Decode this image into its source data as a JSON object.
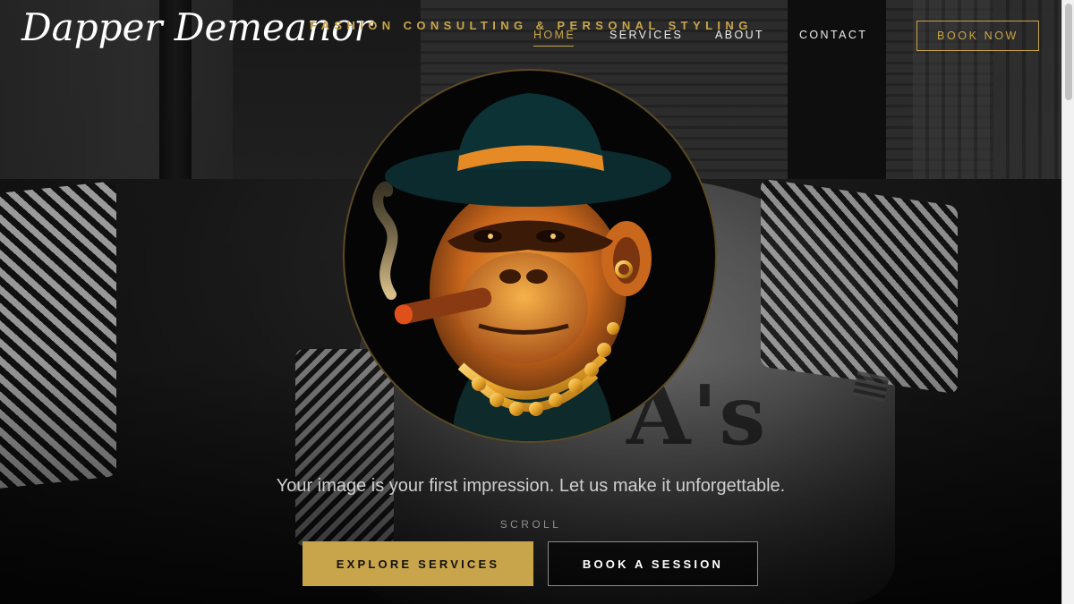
{
  "brand": {
    "logo_text": "Dapper Demeanor",
    "tagline": "FASHION CONSULTING & PERSONAL STYLING",
    "accent_color": "#c8a54a"
  },
  "nav": {
    "items": [
      {
        "label": "HOME",
        "active": true
      },
      {
        "label": "SERVICES",
        "active": false
      },
      {
        "label": "ABOUT",
        "active": false
      },
      {
        "label": "CONTACT",
        "active": false
      }
    ],
    "cta_label": "BOOK NOW"
  },
  "hero": {
    "emblem_icon": "gorilla-bowler-hat-cigar-gold-chain-icon",
    "headline": "Your image is your first impression. Let us make it unforgettable.",
    "scroll_label": "SCROLL",
    "primary_button": "EXPLORE SERVICES",
    "secondary_button": "BOOK A SESSION"
  }
}
